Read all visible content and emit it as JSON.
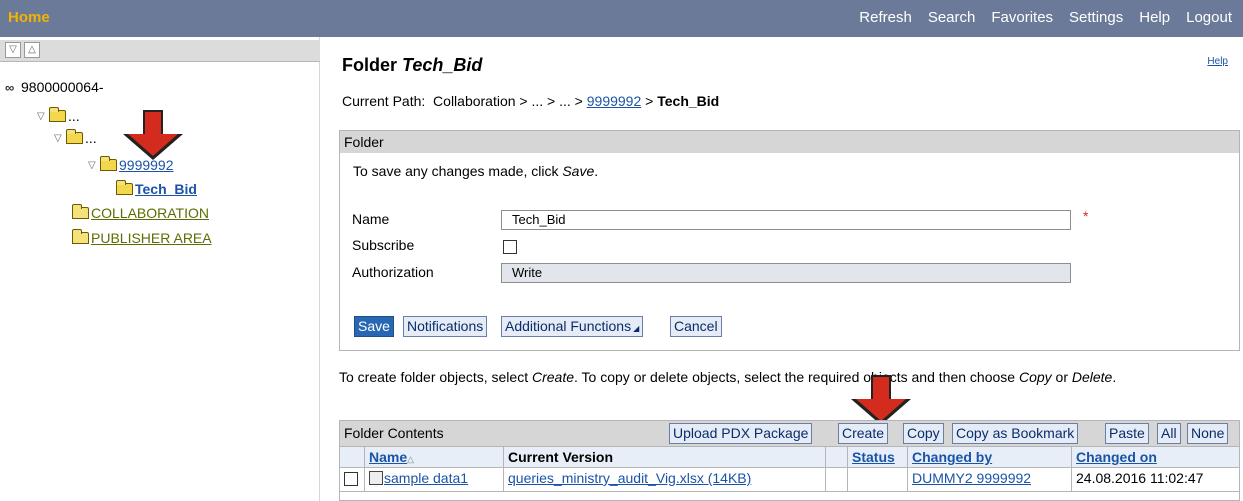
{
  "topbar": {
    "home": "Home",
    "nav": [
      "Refresh",
      "Search",
      "Favorites",
      "Settings",
      "Help",
      "Logout"
    ]
  },
  "tree": {
    "root": "9800000064-",
    "level1": "...",
    "level2": "...",
    "level3": "9999992",
    "current": "Tech_Bid",
    "collab": "COLLABORATION",
    "publisher": "PUBLISHER AREA"
  },
  "page": {
    "title_prefix": "Folder ",
    "title_name": "Tech_Bid",
    "help": "Help",
    "path_label": "Current Path:",
    "path_trail": "Collaboration > ... > ... > ",
    "path_link": "9999992",
    "path_sep": " > ",
    "path_current": "Tech_Bid"
  },
  "folder_box": {
    "header": "Folder",
    "info_text": "To save any changes made, click ",
    "info_em": "Save",
    "info_end": ".",
    "name_label": "Name",
    "name_value": "Tech_Bid",
    "required_mark": "*",
    "subscribe_label": "Subscribe",
    "auth_label": "Authorization",
    "auth_value": "Write",
    "buttons": {
      "save": "Save",
      "notifications": "Notifications",
      "additional": "Additional Functions",
      "cancel": "Cancel"
    }
  },
  "instructions": {
    "part1": "To create folder objects, select ",
    "create": "Create",
    "part2": ". To copy or delete objects, select the required objects and then choose ",
    "copy": "Copy",
    "part3": " or ",
    "delete": "Delete",
    "part4": "."
  },
  "contents": {
    "label": "Folder Contents",
    "buttons": {
      "upload": "Upload PDX Package",
      "create": "Create",
      "copy": "Copy",
      "bookmark": "Copy as Bookmark",
      "paste": "Paste",
      "all": "All",
      "none": "None"
    },
    "columns": {
      "name": "Name",
      "version": "Current Version",
      "status": "Status",
      "changed_by": "Changed by",
      "changed_on": "Changed on"
    },
    "rows": [
      {
        "name": "sample data1",
        "version": "queries_ministry_audit_Vig.xlsx (14KB)",
        "status": "",
        "changed_by": "DUMMY2 9999992",
        "changed_on": "24.08.2016 11:02:47"
      }
    ]
  }
}
